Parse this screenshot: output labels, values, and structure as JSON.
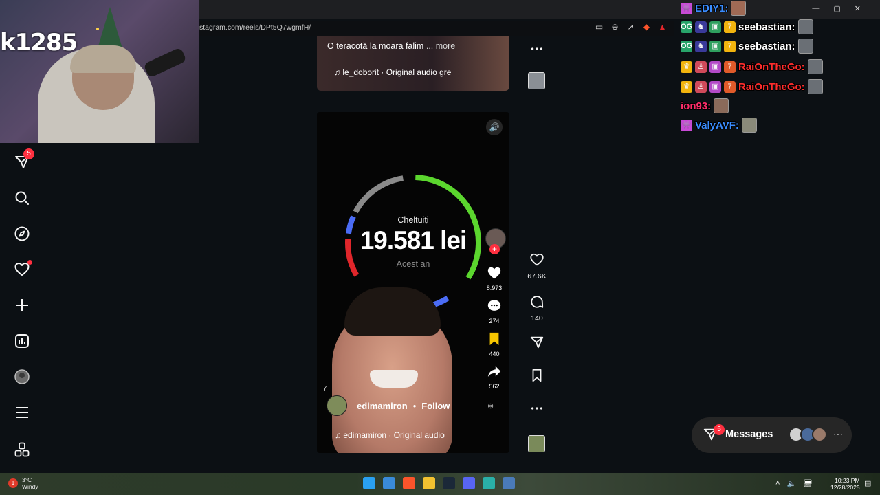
{
  "browser": {
    "url": "stagram.com/reels/DPt5Q7wgmfH/",
    "window_controls": [
      "—",
      "▢",
      "✕"
    ]
  },
  "stream": {
    "counter": "k1285"
  },
  "sidebar": {
    "items": [
      {
        "name": "direct-messages",
        "badge": "5"
      },
      {
        "name": "search"
      },
      {
        "name": "explore"
      },
      {
        "name": "notifications"
      },
      {
        "name": "create"
      },
      {
        "name": "dashboard"
      },
      {
        "name": "profile"
      },
      {
        "name": "more"
      },
      {
        "name": "also-from-meta"
      }
    ]
  },
  "previous_reel": {
    "caption": "O teracotă la moara falim",
    "more": "... more",
    "audio": "le_doborit · Original audio  gre"
  },
  "reel": {
    "mute_icon": "speaker-icon",
    "gauge_top_label": "Cheltuiți",
    "gauge_amount": "19.581 lei",
    "gauge_bottom_label": "Acest an",
    "gauge_colors": [
      "#5bd62e",
      "#4b6cf5",
      "#e0262b",
      "#8a8a8a"
    ],
    "inner_likes": "8.973",
    "inner_comments": "274",
    "inner_saves": "440",
    "inner_shares": "562",
    "views_prefix": "7",
    "author": "edimamiron",
    "separator": "•",
    "follow": "Follow",
    "audio": "edimamiron · Original audio"
  },
  "actions": {
    "likes": "67.6K",
    "comments": "140"
  },
  "chat": [
    {
      "name": "EDIY1:",
      "color": "#3a8cff"
    },
    {
      "name": "seebastian:",
      "color": "#ffffff"
    },
    {
      "name": "seebastian:",
      "color": "#ffffff"
    },
    {
      "name": "RaiOnTheGo:",
      "color": "#ff2d2d"
    },
    {
      "name": "RaiOnTheGo:",
      "color": "#ff2d2d"
    },
    {
      "name": "ion93:",
      "color": "#ff2d6a"
    },
    {
      "name": "ValyAVF:",
      "color": "#3a8cff"
    }
  ],
  "messages": {
    "label": "Messages",
    "badge": "5",
    "more": "···"
  },
  "taskbar": {
    "weather_badge": "1",
    "temperature": "3°C",
    "condition": "Windy",
    "time": "10:23 PM",
    "date": "12/28/2025"
  }
}
